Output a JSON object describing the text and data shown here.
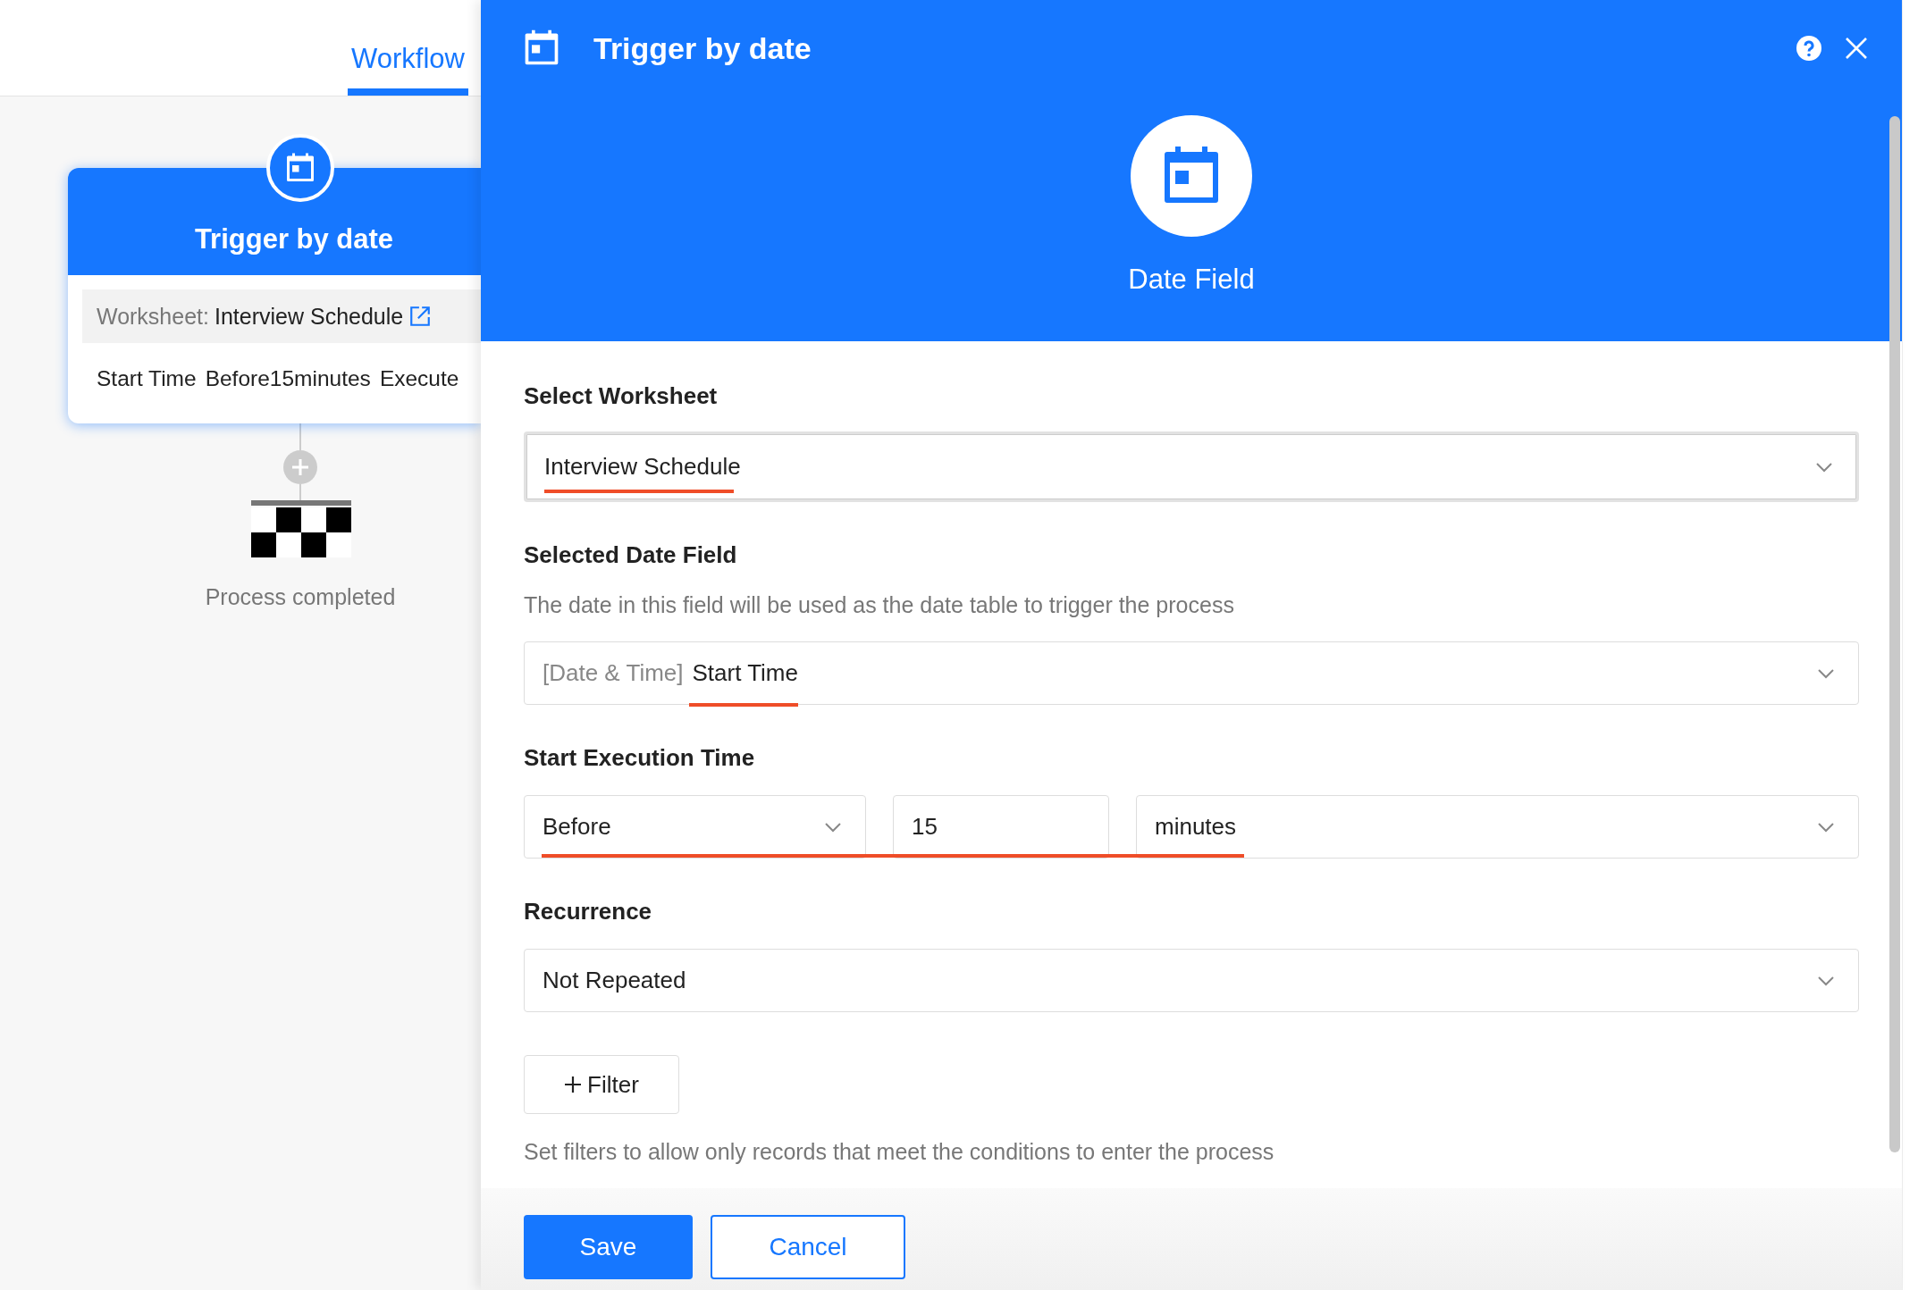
{
  "nav": {
    "tabs": [
      {
        "label": "Workflow",
        "selected": true
      }
    ]
  },
  "flow": {
    "trigger": {
      "title": "Trigger by date",
      "worksheet_label": "Worksheet:",
      "worksheet": "Interview Schedule",
      "summary": [
        "Start Time",
        "Before15minutes",
        "Execute"
      ]
    },
    "end": {
      "label": "Process completed"
    }
  },
  "drawer": {
    "title": "Trigger by date",
    "type_label": "Date Field",
    "worksheet": {
      "label": "Select Worksheet",
      "value": "Interview Schedule",
      "underlined": true
    },
    "date_field": {
      "label": "Selected Date Field",
      "hint": "The date in this field will be used as the date table to trigger the process",
      "type": "[Date & Time]",
      "value": "Start Time",
      "underlined": true
    },
    "execution": {
      "label": "Start Execution Time",
      "timing": "Before",
      "amount": "15",
      "unit": "minutes",
      "underlined": true
    },
    "recurrence": {
      "label": "Recurrence",
      "value": "Not Repeated"
    },
    "filter": {
      "button": "Filter",
      "hint": "Set filters to allow only records that meet the conditions to enter the process"
    },
    "buttons": [
      {
        "label": "Save",
        "kind": "primary"
      },
      {
        "label": "Cancel",
        "kind": "secondary"
      }
    ]
  }
}
